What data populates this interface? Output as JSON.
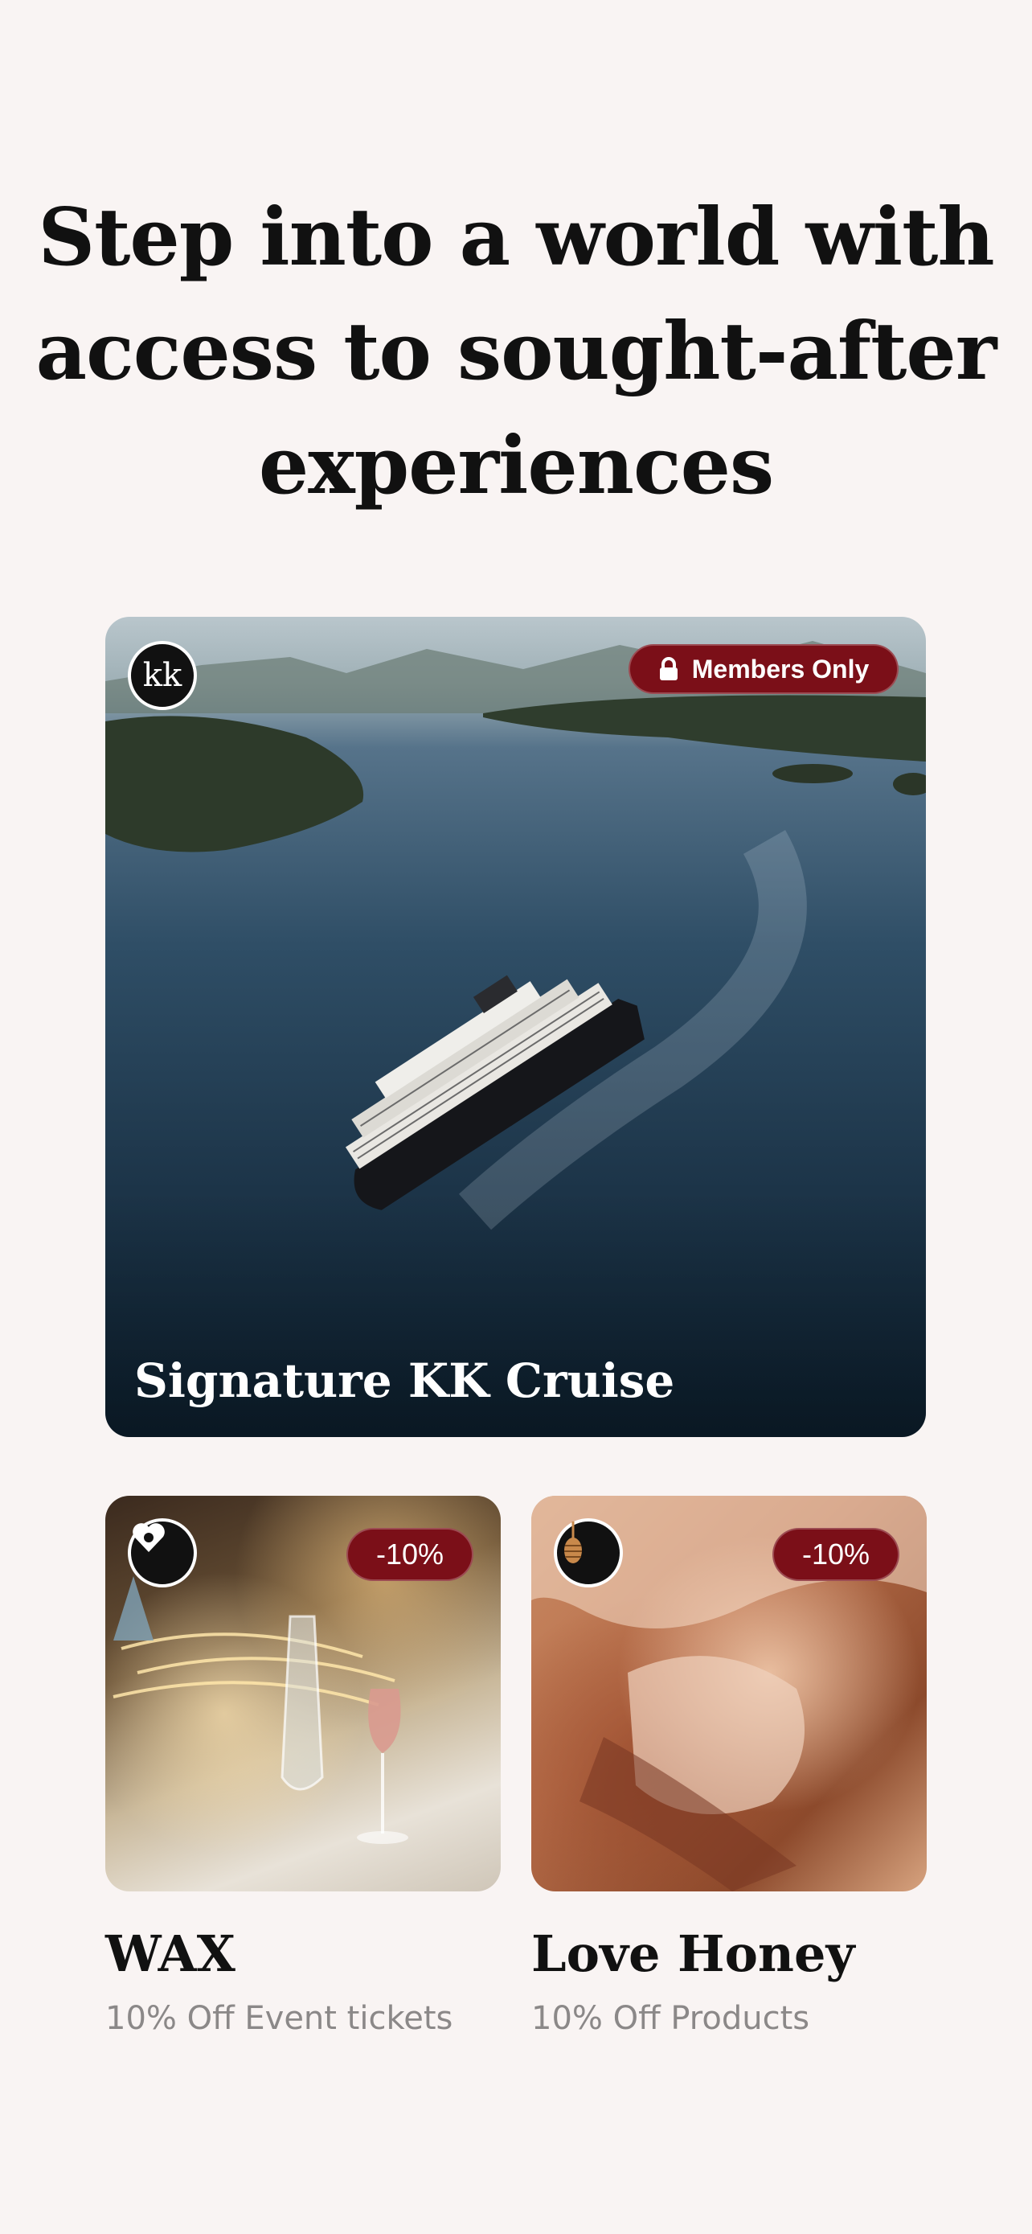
{
  "headline": {
    "line1": "Step into a world with",
    "line2": "access to sought-after",
    "line3": "experiences"
  },
  "hero_card": {
    "logo_text": "kk",
    "badge_icon": "lock-icon",
    "badge_label": "Members Only",
    "title": "Signature KK Cruise"
  },
  "offers": [
    {
      "logo_icon": "heart-logo-icon",
      "discount": "-10%",
      "title": "WAX",
      "subtitle": "10% Off Event tickets"
    },
    {
      "logo_icon": "honey-dipper-icon",
      "discount": "-10%",
      "title": "Love Honey",
      "subtitle": "10% Off Products"
    }
  ],
  "colors": {
    "background": "#f9f4f3",
    "badge": "#7b0f18",
    "title_text": "#111111",
    "subtitle_text": "#8b8888"
  }
}
